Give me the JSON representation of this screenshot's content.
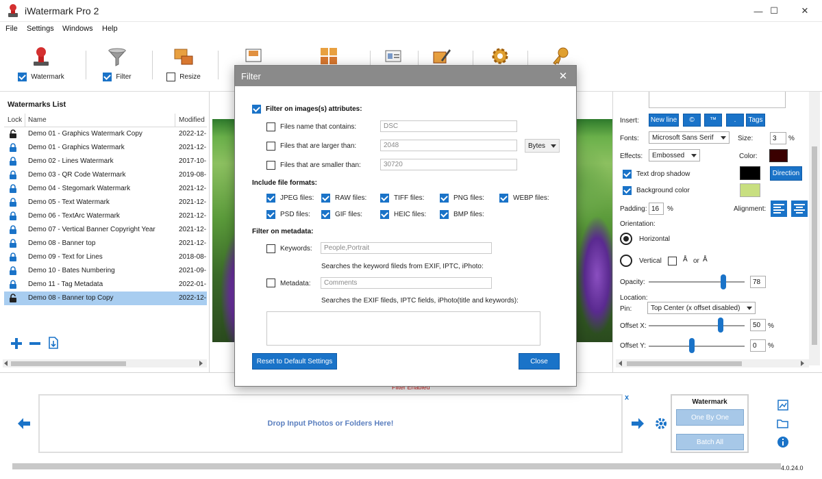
{
  "window": {
    "title": "iWatermark Pro 2",
    "minimize": "—",
    "maximize": "☐",
    "close": "✕"
  },
  "menu": [
    "File",
    "Settings",
    "Windows",
    "Help"
  ],
  "toolbar": {
    "watermark_label": "Watermark",
    "filter_label": "Filter",
    "resize_label": "Resize",
    "watermark_checked": true,
    "filter_checked": true,
    "resize_checked": false
  },
  "watermarks": {
    "title": "Watermarks List",
    "columns": [
      "Lock",
      "Name",
      "Modified"
    ],
    "rows": [
      {
        "name": "Demo 01 - Graphics Watermark Copy",
        "modified": "2022-12-",
        "locked": false
      },
      {
        "name": "Demo 01 - Graphics Watermark",
        "modified": "2021-12-",
        "locked": true
      },
      {
        "name": "Demo 02 - Lines Watermark",
        "modified": "2017-10-",
        "locked": true
      },
      {
        "name": "Demo 03 - QR Code Watermark",
        "modified": "2019-08-",
        "locked": true
      },
      {
        "name": "Demo 04 - Stegomark Watermark",
        "modified": "2021-12-",
        "locked": true
      },
      {
        "name": "Demo 05 - Text Watermark",
        "modified": "2021-12-",
        "locked": true
      },
      {
        "name": "Demo 06 - TextArc Watermark",
        "modified": "2021-12-",
        "locked": true
      },
      {
        "name": "Demo 07 - Vertical Banner Copyright Year",
        "modified": "2021-12-",
        "locked": true
      },
      {
        "name": "Demo 08 - Banner top",
        "modified": "2021-12-",
        "locked": true
      },
      {
        "name": "Demo 09 - Text for Lines",
        "modified": "2018-08-",
        "locked": true
      },
      {
        "name": "Demo 10 - Bates Numbering",
        "modified": "2021-09-",
        "locked": true
      },
      {
        "name": "Demo 11 - Tag Metadata",
        "modified": "2022-01-",
        "locked": true
      },
      {
        "name": "Demo 08 - Banner top Copy",
        "modified": "2022-12-",
        "locked": false,
        "selected": true
      }
    ]
  },
  "right": {
    "insert_label": "Insert:",
    "new_line": "New line",
    "copyright_symbol": "©",
    "tm_symbol": "™",
    "dot_symbol": ".",
    "tags": "Tags",
    "fonts_label": "Fonts:",
    "font_value": "Microsoft Sans Serif",
    "size_label": "Size:",
    "size_value": "3",
    "pct": "%",
    "effects_label": "Effects:",
    "effects_value": "Embossed",
    "color_label": "Color:",
    "text_drop_shadow": "Text drop shadow",
    "direction": "Direction",
    "background_color": "Background color",
    "padding_label": "Padding:",
    "padding_value": "16",
    "alignment_label": "Alignment:",
    "orientation_label": "Orientation:",
    "horizontal": "Horizontal",
    "vertical": "Vertical",
    "or": "or",
    "opacity_label": "Opacity:",
    "opacity_value": "78",
    "opacity_level": 0.78,
    "location_label": "Location:",
    "pin_label": "Pin:",
    "pin_value": "Top Center (x offset disabled)",
    "offset_x_label": "Offset X:",
    "offset_x_value": "50",
    "offset_x_level": 0.75,
    "offset_y_label": "Offset Y:",
    "offset_y_value": "0",
    "offset_y_level": 0.45,
    "colors": {
      "text": "#3a0000",
      "shadow": "#000000",
      "background": "#c8df80"
    }
  },
  "filter_dialog": {
    "title": "Filter",
    "filter_on_attributes": "Filter on images(s) attributes:",
    "name_contains_label": "Files name that contains:",
    "name_contains_value": "DSC",
    "larger_label": "Files that are larger than:",
    "larger_value": "2048",
    "unit_value": "Bytes",
    "smaller_label": "Files that are smaller than:",
    "smaller_value": "30720",
    "include_formats": "Include file formats:",
    "formats": [
      "JPEG files:",
      "RAW files:",
      "TIFF files:",
      "PNG files:",
      "WEBP files:",
      "PSD files:",
      "GIF files:",
      "HEIC files:",
      "BMP files:"
    ],
    "filter_on_metadata": "Filter on metadata:",
    "keywords_label": "Keywords:",
    "keywords_value": "People,Portrait",
    "keywords_hint": "Searches the keyword fileds from EXIF, IPTC, iPhoto:",
    "metadata_label": "Metadata:",
    "metadata_placeholder": "Comments",
    "metadata_hint": "Searches the EXIF fileds, IPTC fields, iPhoto(title and keywords):",
    "reset_button": "Reset to Default Settings",
    "close_button": "Close"
  },
  "bottom": {
    "filter_enabled": "Filter Enabled",
    "drop_text": "Drop Input Photos or Folders Here!",
    "clear_x": "x",
    "wm_box_title": "Watermark",
    "one_by_one": "One By One",
    "batch_all": "Batch All",
    "version": "4.0.24.0"
  }
}
